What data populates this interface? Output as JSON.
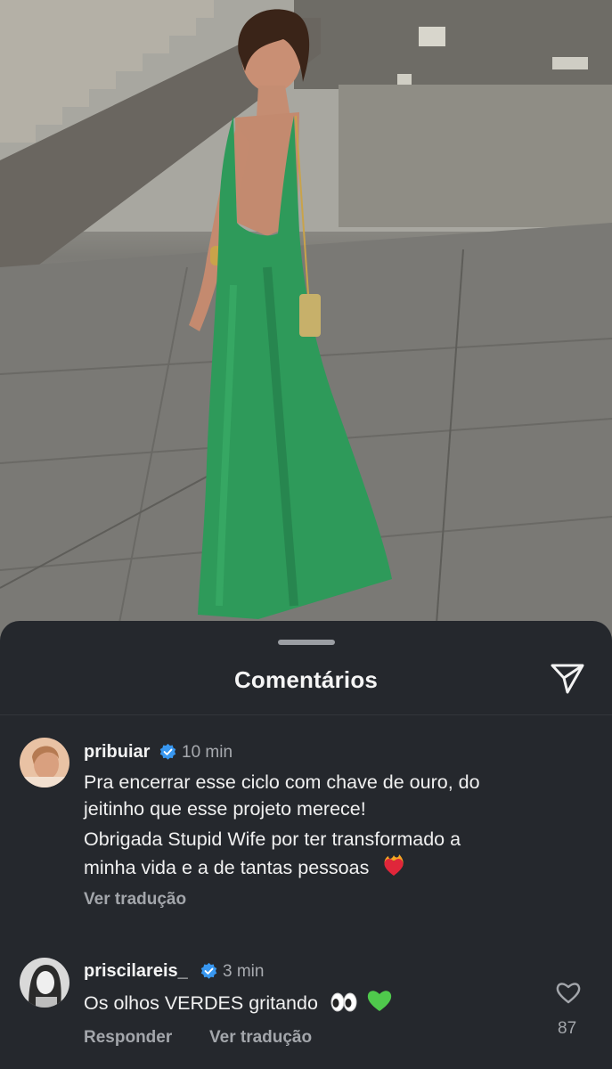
{
  "sheet": {
    "title": "Comentários"
  },
  "comments": [
    {
      "username": "pribuiar",
      "verified": true,
      "time": "10 min",
      "lines": [
        "Pra encerrar esse ciclo com chave de ouro, do",
        "jeitinho que esse projeto merece!",
        "Obrigada Stupid Wife por ter transformado a",
        "minha vida e a de tantas pessoas"
      ],
      "trailing_emoji": "heart-on-fire-emoji",
      "translate_label": "Ver tradução"
    },
    {
      "username": "priscilareis_",
      "verified": true,
      "time": "3 min",
      "text": "Os olhos VERDES gritando",
      "trailing_emojis": [
        "eyes-emoji",
        "green-heart-emoji"
      ],
      "reply_label": "Responder",
      "translate_label": "Ver tradução",
      "likes": "87"
    }
  ],
  "icons": {
    "share": "paper-plane-icon",
    "verified": "verified-badge-icon",
    "like": "heart-outline-icon"
  },
  "colors": {
    "sheet_bg": "#25282d",
    "verified_blue": "#3897f0",
    "secondary_text": "#a8abb0",
    "dress_green": "#2e9a5a"
  }
}
